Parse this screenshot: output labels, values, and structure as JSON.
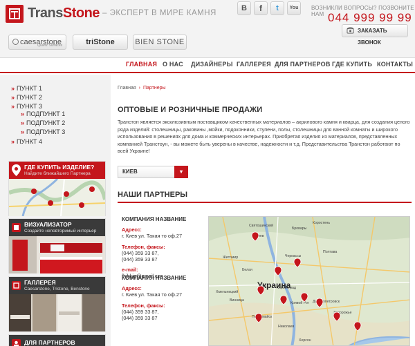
{
  "header": {
    "brand_main": "Trans",
    "brand_accent": "Stone",
    "tagline": "– ЭКСПЕРТ В МИРЕ КАМНЯ",
    "question": "ВОЗНИКЛИ ВОПРОСЫ? ПОЗВОНИТЕ НАМ",
    "phone": "044  999 99 99",
    "call_button": "ЗАКАЗАТЬ ЗВОНОК",
    "social": [
      {
        "icon": "vk-icon",
        "glyph": "B"
      },
      {
        "icon": "facebook-icon",
        "glyph": "f"
      },
      {
        "icon": "twitter-icon",
        "glyph": "t"
      },
      {
        "icon": "youtube-icon",
        "glyph": "You"
      }
    ],
    "brands": {
      "caesarstone": "caesarstone",
      "caesarstone_sub": "Quartz Surfaces",
      "tristone": "triStone",
      "bienstone": "BIEN STONE"
    }
  },
  "nav": {
    "items": [
      "ГЛАВНАЯ",
      "О НАС",
      "ДИЗАЙНЕРЫ",
      "ГАЛЛЕРЕЯ",
      "ДЛЯ ПАРТНЕРОВ",
      "ГДЕ КУПИТЬ",
      "КОНТАКТЫ"
    ],
    "active": "ГЛАВНАЯ"
  },
  "sidebar": {
    "menu": [
      "ПУНКТ 1",
      "ПУНКТ 2",
      "ПУНКТ 3",
      "ПОДПУНКТ 1",
      "ПОДПУНКТ 2",
      "ПОДПУНКТ 3",
      "ПУНКТ 4"
    ],
    "cards": [
      {
        "title": "ГДЕ КУПИТЬ ИЗДЕЛИЕ?",
        "sub": "Найдите ближайшего Партнера"
      },
      {
        "title": "ВИЗУАЛИЗАТОР",
        "sub": "Создайте неповторимый интерьер"
      },
      {
        "title": "ГАЛЛЕРЕЯ",
        "sub": "Caesarstone, Tristone, Benstone"
      },
      {
        "title": "ДЛЯ ПАРТНЕРОВ",
        "sub": ""
      }
    ]
  },
  "breadcrumb": {
    "home": "Главная",
    "current": "Партнеры"
  },
  "main": {
    "title": "ОПТОВЫЕ И РОЗНИЧНЫЕ ПРОДАЖИ",
    "intro": "Транстон является эксклюзивным поставщиком качественных материалов – акрилового камня и кварца,  для создания целого ряда изделий: столешницы, раковины ,мойки, подоконники, ступени,  полы, столешницы для ванной комнаты и широкого использования в решениях для дома и коммерческих интерьерах. Приобретая изделия из материалов, представленных компанией Транстоун, - вы можете быть уверены в качестве, надежности и т.д. Представительства Транстон работают по всей Украине!",
    "city": "КИЕВ",
    "partners_title": "НАШИ ПАРТНЕРЫ",
    "companies": [
      {
        "name": "КОМПАНИЯ НАЗВАНИЕ",
        "addr_label": "Адресс:",
        "addr": "г. Киев ул. Такая то оф.27",
        "phone_label": "Телефон, факсы:",
        "phones": [
          "(044) 359 33 87,",
          "(044) 359 33 87"
        ],
        "email_label": "e-mail:",
        "email": "fhjhkjg@gmail.con"
      },
      {
        "name": "КОМПАНИЯ НАЗВАНИЕ",
        "addr_label": "Адресс:",
        "addr": "г. Киев ул. Такая то оф.27",
        "phone_label": "Телефон, факсы:",
        "phones": [
          "(044) 359 33 87,",
          "(044) 359 33 87"
        ]
      }
    ],
    "map": {
      "country": "Украина",
      "cities": [
        "Киев",
        "Винница",
        "Черкассы",
        "Кировоград",
        "Днепропетровск",
        "Запорожье",
        "Кривой Рог",
        "Полтава",
        "Житомир",
        "Святошинский",
        "Бровары",
        "Белая",
        "Коростень",
        "Хмельницкий",
        "Первомайск",
        "Николаев",
        "Херсон"
      ]
    }
  },
  "colors": {
    "accent": "#c4161c",
    "background": "#f2f2f2"
  }
}
